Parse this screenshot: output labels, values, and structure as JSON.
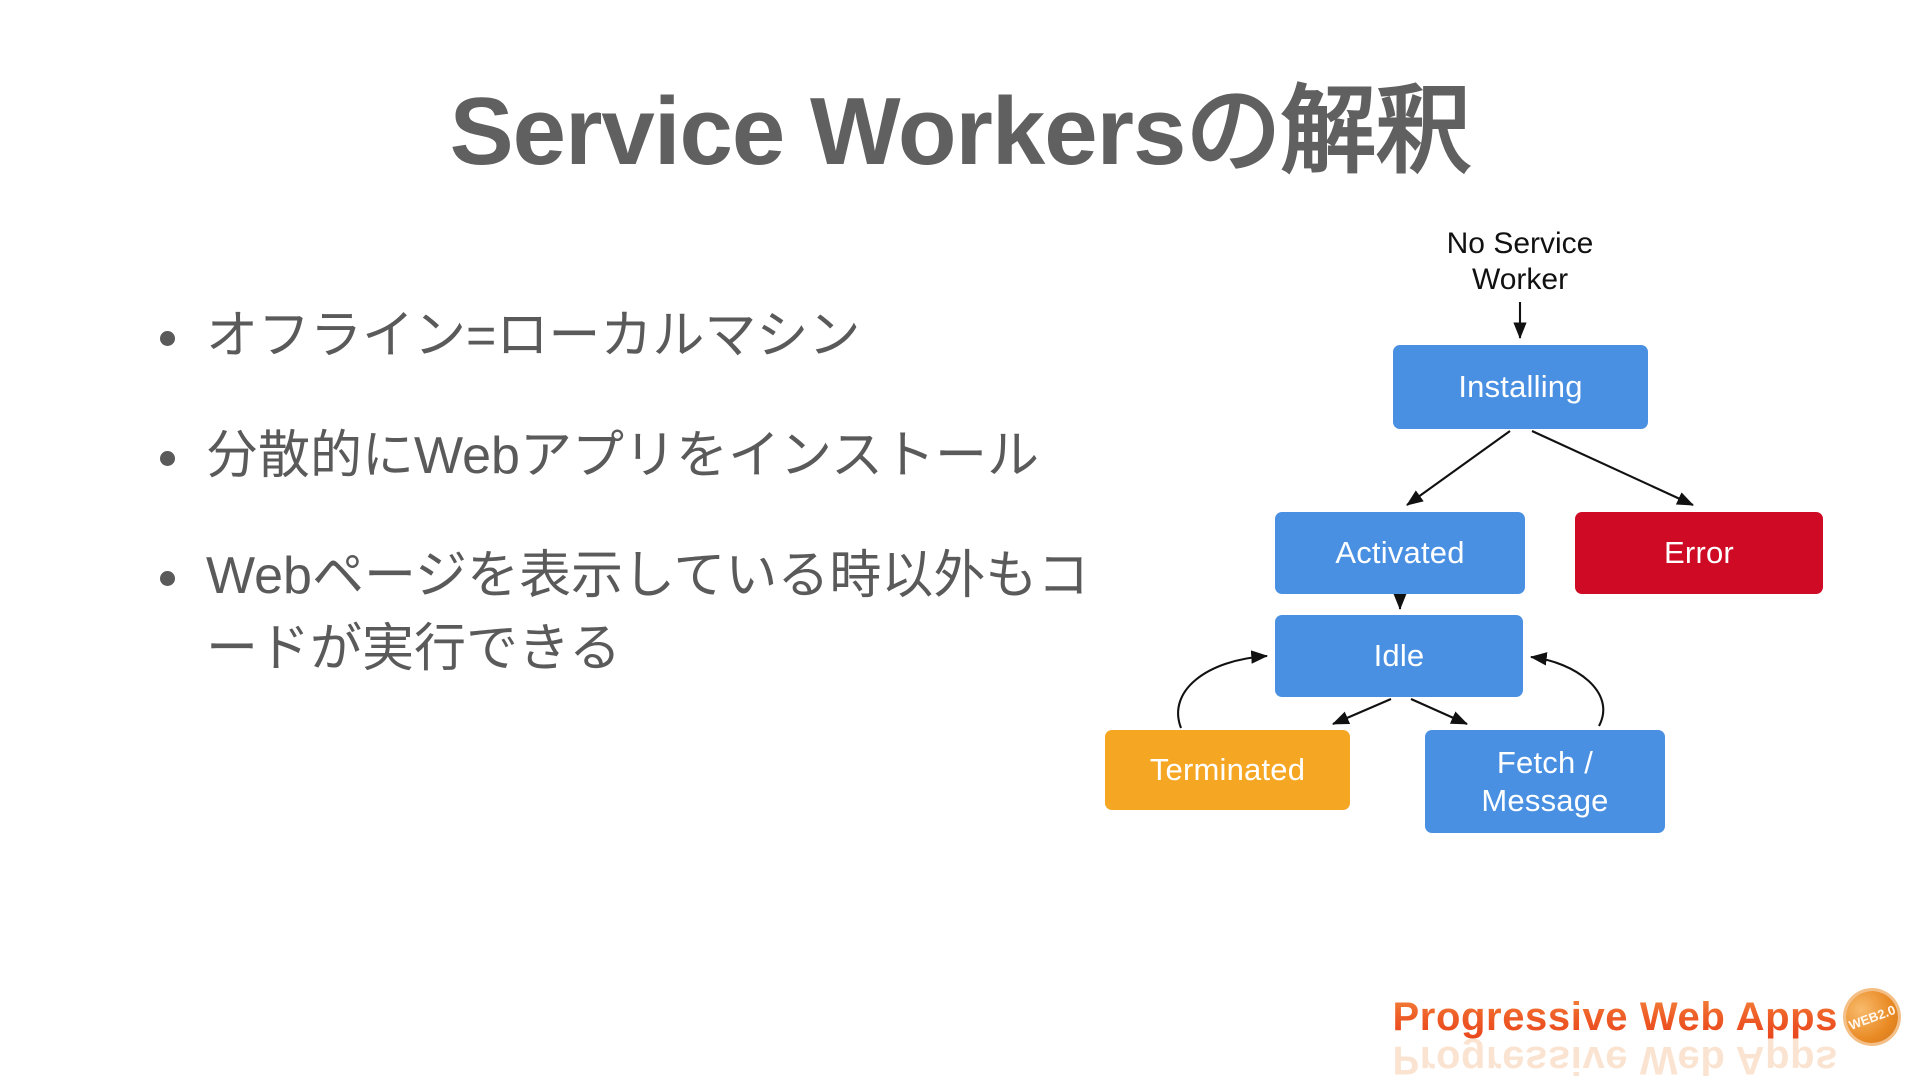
{
  "slide": {
    "title": "Service Workersの解釈"
  },
  "bullets": [
    {
      "text": "オフライン=ローカルマシン"
    },
    {
      "text": "分散的にWebアプリをインストール"
    },
    {
      "text": "Webページを表示している時以外もコードが実行できる"
    }
  ],
  "diagram": {
    "entry_label": "No Service\nWorker",
    "nodes": [
      {
        "id": "installing",
        "label": "Installing",
        "color": "#4a90e2"
      },
      {
        "id": "activated",
        "label": "Activated",
        "color": "#4a90e2"
      },
      {
        "id": "error",
        "label": "Error",
        "color": "#cf0a24"
      },
      {
        "id": "idle",
        "label": "Idle",
        "color": "#4a90e2"
      },
      {
        "id": "terminated",
        "label": "Terminated",
        "color": "#f5a623"
      },
      {
        "id": "fetch",
        "label": "Fetch /\nMessage",
        "color": "#4a90e2"
      }
    ],
    "edges": [
      {
        "from": "no-service-worker",
        "to": "installing"
      },
      {
        "from": "installing",
        "to": "activated"
      },
      {
        "from": "installing",
        "to": "error"
      },
      {
        "from": "activated",
        "to": "idle"
      },
      {
        "from": "idle",
        "to": "terminated"
      },
      {
        "from": "idle",
        "to": "fetch"
      },
      {
        "from": "terminated",
        "to": "idle"
      },
      {
        "from": "fetch",
        "to": "idle"
      }
    ]
  },
  "logo": {
    "text": "Progressive Web Apps",
    "badge": "WEB2.0"
  },
  "colors": {
    "title": "#606060",
    "body_text": "#5a5a5a",
    "node_blue": "#4a90e2",
    "node_red": "#cf0a24",
    "node_orange": "#f5a623",
    "background": "#ffffff"
  }
}
